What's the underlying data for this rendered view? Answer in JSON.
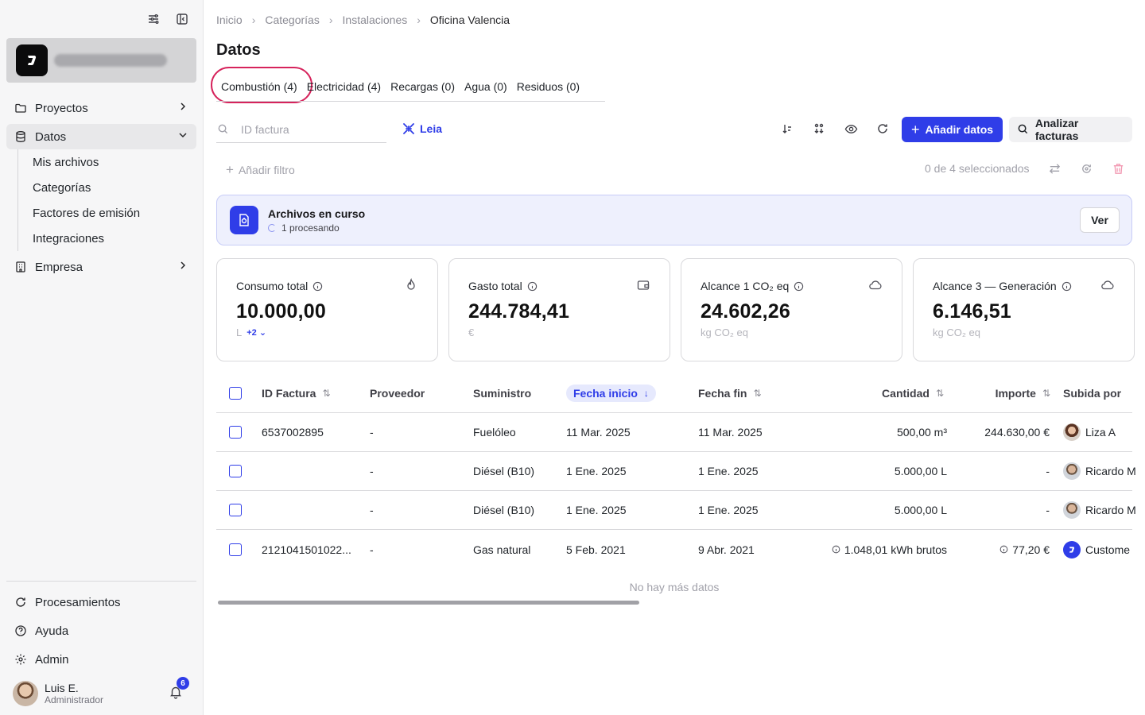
{
  "sidebar": {
    "nav": [
      {
        "label": "Proyectos"
      },
      {
        "label": "Datos"
      },
      {
        "label": "Empresa"
      }
    ],
    "datos_sub": [
      "Mis archivos",
      "Categorías",
      "Factores de emisión",
      "Integraciones"
    ],
    "bottom": [
      {
        "label": "Procesamientos"
      },
      {
        "label": "Ayuda"
      },
      {
        "label": "Admin"
      }
    ],
    "user": {
      "name": "Luis E.",
      "role": "Administrador",
      "notifications": "6"
    }
  },
  "breadcrumb": [
    "Inicio",
    "Categorías",
    "Instalaciones",
    "Oficina Valencia"
  ],
  "page_title": "Datos",
  "tabs": [
    "Combustión (4)",
    "Electricidad (4)",
    "Recargas (0)",
    "Agua (0)",
    "Residuos (0)"
  ],
  "search": {
    "placeholder": "ID factura",
    "value": ""
  },
  "leia_label": "Leia",
  "toolbar": {
    "add_label": "Añadir datos",
    "analyze_label": "Analizar facturas"
  },
  "filter": {
    "add_label": "Añadir filtro",
    "selection": "0 de 4 seleccionados"
  },
  "banner": {
    "title": "Archivos en curso",
    "subtitle": "1 procesando",
    "button": "Ver"
  },
  "cards": [
    {
      "label": "Consumo total",
      "value": "10.000,00",
      "unit": "L",
      "extra": "+2",
      "icon": "flame-icon"
    },
    {
      "label": "Gasto total",
      "value": "244.784,41",
      "unit": "€",
      "icon": "wallet-icon"
    },
    {
      "label": "Alcance 1 CO₂ eq",
      "value": "24.602,26",
      "unit": "kg CO₂ eq",
      "icon": "cloud-icon"
    },
    {
      "label": "Alcance 3 — Generación",
      "value": "6.146,51",
      "unit": "kg CO₂ eq",
      "icon": "cloud-icon"
    }
  ],
  "table": {
    "headers": [
      "ID Factura",
      "Proveedor",
      "Suministro",
      "Fecha inicio",
      "Fecha fin",
      "Cantidad",
      "Importe",
      "Subida por"
    ],
    "rows": [
      {
        "id": "6537002895",
        "proveedor": "-",
        "suministro": "Fuelóleo",
        "inicio": "11 Mar. 2025",
        "fin": "11 Mar. 2025",
        "cantidad": "500,00 m³",
        "importe": "244.630,00 €",
        "subida": "Liza A"
      },
      {
        "id": "",
        "proveedor": "-",
        "suministro": "Diésel (B10)",
        "inicio": "1 Ene. 2025",
        "fin": "1 Ene. 2025",
        "cantidad": "5.000,00 L",
        "importe": "-",
        "subida": "Ricardo M"
      },
      {
        "id": "",
        "proveedor": "-",
        "suministro": "Diésel (B10)",
        "inicio": "1 Ene. 2025",
        "fin": "1 Ene. 2025",
        "cantidad": "5.000,00 L",
        "importe": "-",
        "subida": "Ricardo M"
      },
      {
        "id": "2121041501022...",
        "proveedor": "-",
        "suministro": "Gas natural",
        "inicio": "5 Feb. 2021",
        "fin": "9 Abr. 2021",
        "cantidad": "1.048,01 kWh brutos",
        "importe": "77,20 €",
        "subida": "Custome"
      }
    ],
    "footer": "No hay más datos"
  },
  "colors": {
    "accent": "#2f3de8",
    "highlight": "#d6235c"
  }
}
